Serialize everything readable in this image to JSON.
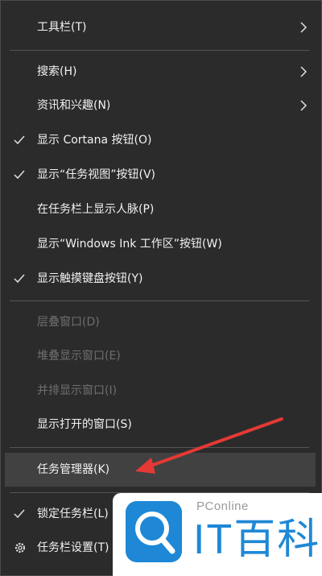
{
  "menu": {
    "items": [
      {
        "label": "工具栏(T)",
        "checked": false,
        "disabled": false,
        "submenu": true
      },
      {
        "label": "搜索(H)",
        "checked": false,
        "disabled": false,
        "submenu": true
      },
      {
        "label": "资讯和兴趣(N)",
        "checked": false,
        "disabled": false,
        "submenu": true
      },
      {
        "label": "显示 Cortana 按钮(O)",
        "checked": true,
        "disabled": false,
        "submenu": false
      },
      {
        "label": "显示“任务视图”按钮(V)",
        "checked": true,
        "disabled": false,
        "submenu": false
      },
      {
        "label": "在任务栏上显示人脉(P)",
        "checked": false,
        "disabled": false,
        "submenu": false
      },
      {
        "label": "显示“Windows Ink 工作区”按钮(W)",
        "checked": false,
        "disabled": false,
        "submenu": false
      },
      {
        "label": "显示触摸键盘按钮(Y)",
        "checked": true,
        "disabled": false,
        "submenu": false
      },
      {
        "label": "层叠窗口(D)",
        "checked": false,
        "disabled": true,
        "submenu": false
      },
      {
        "label": "堆叠显示窗口(E)",
        "checked": false,
        "disabled": true,
        "submenu": false
      },
      {
        "label": "并排显示窗口(I)",
        "checked": false,
        "disabled": true,
        "submenu": false
      },
      {
        "label": "显示打开的窗口(S)",
        "checked": false,
        "disabled": false,
        "submenu": false
      },
      {
        "label": "任务管理器(K)",
        "checked": false,
        "disabled": false,
        "submenu": false,
        "highlighted": true
      },
      {
        "label": "锁定任务栏(L)",
        "checked": true,
        "disabled": false,
        "submenu": false
      },
      {
        "label": "任务栏设置(T)",
        "checked": false,
        "disabled": false,
        "submenu": false,
        "icon": "gear-icon"
      }
    ]
  },
  "watermark": {
    "small_text": "PConline",
    "big_text": "IT百科"
  },
  "colors": {
    "menu_bg": "#2b2b2b",
    "text": "#f2f2f2",
    "disabled_text": "#6f6f6f",
    "highlight_bg": "#414141",
    "annotation_red": "#e53935",
    "brand_blue": "#1e88d6"
  }
}
